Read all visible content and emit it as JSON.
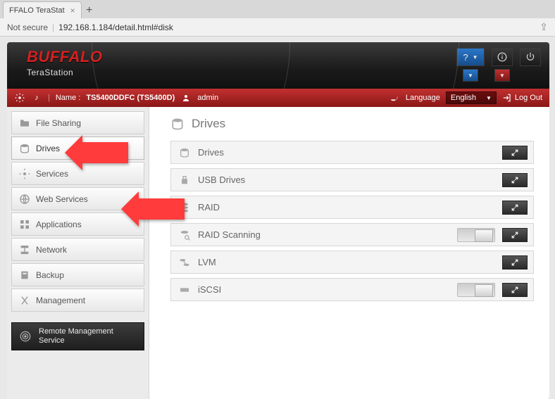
{
  "browser": {
    "tab_title": "FFALO TeraStat",
    "security": "Not secure",
    "url": "192.168.1.184/detail.html#disk"
  },
  "brand": {
    "name": "BUFFALO",
    "product": "TeraStation"
  },
  "header": {
    "help_label": "?"
  },
  "status": {
    "name_label": "Name :",
    "name_value": "TS5400DDFC (TS5400D)",
    "user": "admin",
    "language_label": "Language",
    "language_value": "English",
    "logout": "Log Out"
  },
  "sidebar": {
    "items": [
      {
        "label": "File Sharing",
        "id": "file-sharing"
      },
      {
        "label": "Drives",
        "id": "drives"
      },
      {
        "label": "Services",
        "id": "services"
      },
      {
        "label": "Web Services",
        "id": "web-services"
      },
      {
        "label": "Applications",
        "id": "applications"
      },
      {
        "label": "Network",
        "id": "network"
      },
      {
        "label": "Backup",
        "id": "backup"
      },
      {
        "label": "Management",
        "id": "management"
      }
    ],
    "remote": {
      "line1": "Remote Management",
      "line2": "Service"
    }
  },
  "main": {
    "title": "Drives",
    "rows": [
      {
        "label": "Drives",
        "toggle": false,
        "id": "drives"
      },
      {
        "label": "USB Drives",
        "toggle": false,
        "id": "usb-drives"
      },
      {
        "label": "RAID",
        "toggle": false,
        "id": "raid"
      },
      {
        "label": "RAID Scanning",
        "toggle": true,
        "id": "raid-scanning"
      },
      {
        "label": "LVM",
        "toggle": false,
        "id": "lvm"
      },
      {
        "label": "iSCSI",
        "toggle": true,
        "id": "iscsi"
      }
    ]
  }
}
